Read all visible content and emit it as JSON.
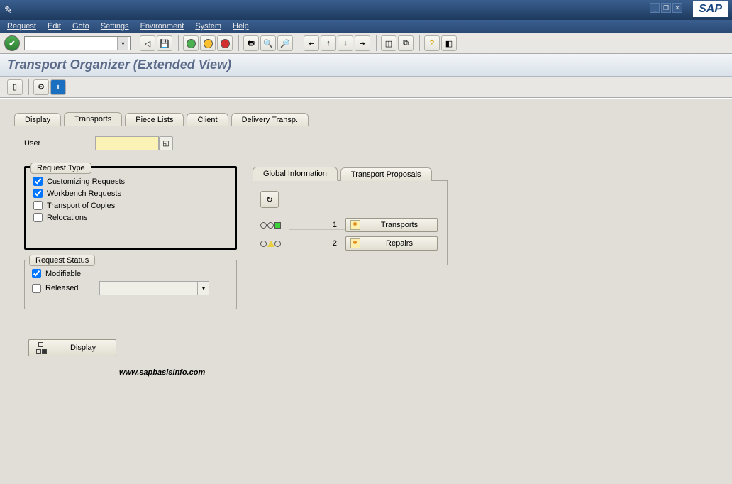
{
  "menu": {
    "request": "Request",
    "edit": "Edit",
    "goto": "Goto",
    "settings": "Settings",
    "environment": "Environment",
    "system": "System",
    "help": "Help"
  },
  "title": "Transport Organizer (Extended View)",
  "tabs": {
    "display": "Display",
    "transports": "Transports",
    "piece_lists": "Piece Lists",
    "client": "Client",
    "delivery": "Delivery Transp."
  },
  "user": {
    "label": "User",
    "value": ""
  },
  "request_type": {
    "legend": "Request Type",
    "customizing": {
      "label": "Customizing Requests",
      "checked": true
    },
    "workbench": {
      "label": "Workbench Requests",
      "checked": true
    },
    "transport_copies": {
      "label": "Transport of Copies",
      "checked": false
    },
    "relocations": {
      "label": "Relocations",
      "checked": false
    }
  },
  "request_status": {
    "legend": "Request Status",
    "modifiable": {
      "label": "Modifiable",
      "checked": true
    },
    "released": {
      "label": "Released",
      "checked": false,
      "value": ""
    }
  },
  "info_tabs": {
    "global": "Global Information",
    "proposals": "Transport Proposals"
  },
  "info": {
    "transports_count": "1",
    "repairs_count": "2",
    "transports_label": "Transports",
    "repairs_label": "Repairs"
  },
  "buttons": {
    "display": "Display"
  },
  "watermark": "www.sapbasisinfo.com",
  "sap_logo": "SAP"
}
